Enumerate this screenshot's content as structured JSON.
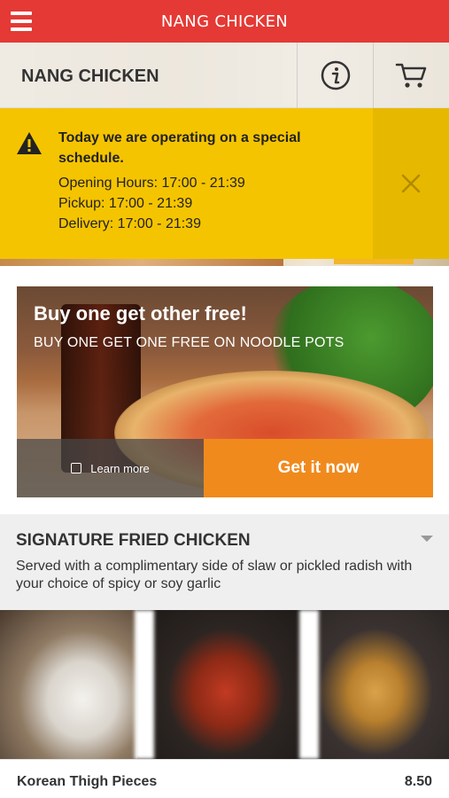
{
  "app": {
    "title": "NANG CHICKEN"
  },
  "header": {
    "restaurant_name": "NANG CHICKEN"
  },
  "icons": {
    "menu": "hamburger-menu-icon",
    "info": "info-icon",
    "cart": "cart-icon",
    "warning": "warning-icon",
    "close": "close-icon",
    "learn": "image-icon"
  },
  "colors": {
    "brand": "#e53935",
    "notice": "#f5c400",
    "cta": "#f08a1d"
  },
  "notice": {
    "headline": "Today we are operating on a special schedule.",
    "opening": "Opening Hours: 17:00 - 21:39",
    "pickup": "Pickup: 17:00 - 21:39",
    "delivery": "Delivery: 17:00 - 21:39"
  },
  "promo": {
    "title": "Buy one get other free!",
    "subtitle": "BUY ONE GET ONE FREE ON NOODLE POTS",
    "learn_more": "Learn more",
    "cta": "Get it now"
  },
  "category": {
    "title": "SIGNATURE FRIED CHICKEN",
    "description": "Served with a complimentary side of slaw or pickled radish with your choice of spicy or soy garlic"
  },
  "items": [
    {
      "name": "Korean Thigh Pieces",
      "price": "8.50"
    }
  ]
}
